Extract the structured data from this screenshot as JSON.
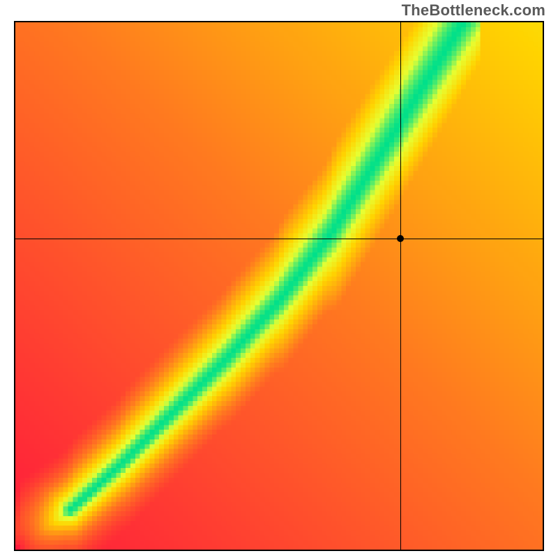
{
  "watermark": "TheBottleneck.com",
  "chart_data": {
    "type": "heatmap",
    "title": "",
    "xlabel": "",
    "ylabel": "",
    "xlim": [
      0,
      100
    ],
    "ylim": [
      0,
      100
    ],
    "grid_resolution": 110,
    "marker": {
      "x": 73,
      "y": 59
    },
    "crosshair": {
      "x": 73,
      "y": 59
    },
    "ridge_curve_samples": [
      {
        "x": 0,
        "y": 0
      },
      {
        "x": 10,
        "y": 7
      },
      {
        "x": 20,
        "y": 16
      },
      {
        "x": 30,
        "y": 26
      },
      {
        "x": 40,
        "y": 36
      },
      {
        "x": 50,
        "y": 47
      },
      {
        "x": 60,
        "y": 60
      },
      {
        "x": 70,
        "y": 76
      },
      {
        "x": 80,
        "y": 92
      },
      {
        "x": 85,
        "y": 100
      }
    ],
    "colorscale": [
      {
        "stop": 0.0,
        "color": "#ff1a3c"
      },
      {
        "stop": 0.4,
        "color": "#ff7a1f"
      },
      {
        "stop": 0.7,
        "color": "#ffd400"
      },
      {
        "stop": 0.86,
        "color": "#e6ff33"
      },
      {
        "stop": 1.0,
        "color": "#00e08a"
      }
    ],
    "annotations": []
  }
}
